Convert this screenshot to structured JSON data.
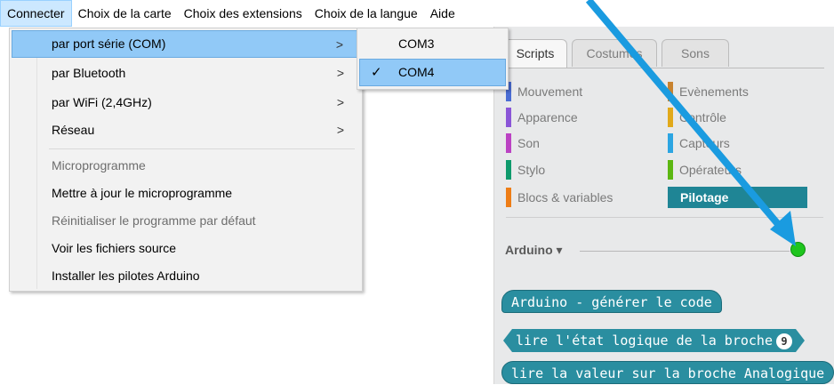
{
  "menubar": {
    "items": [
      "Connecter",
      "Choix de la carte",
      "Choix des extensions",
      "Choix de la langue",
      "Aide"
    ]
  },
  "connect_menu": {
    "items": [
      {
        "label": "par port série (COM)",
        "arrow": ">"
      },
      {
        "label": "par Bluetooth",
        "arrow": ">"
      },
      {
        "label": "par WiFi (2,4GHz)",
        "arrow": ">"
      },
      {
        "label": "Réseau",
        "arrow": ">"
      }
    ],
    "firmware_items": [
      {
        "label": "Microprogramme"
      },
      {
        "label": "Mettre à jour le microprogramme"
      },
      {
        "label": "Réinitialiser le programme par défaut"
      },
      {
        "label": "Voir les fichiers source"
      },
      {
        "label": "Installer les pilotes Arduino"
      }
    ]
  },
  "port_submenu": {
    "items": [
      {
        "label": "COM3",
        "checked": false
      },
      {
        "label": "COM4",
        "checked": true,
        "check_mark": "✓"
      }
    ]
  },
  "tabs": [
    "Scripts",
    "Costumes",
    "Sons"
  ],
  "categories": [
    {
      "label": "Mouvement",
      "color": "#4a6cd4"
    },
    {
      "label": "Evènements",
      "color": "#c88330"
    },
    {
      "label": "Apparence",
      "color": "#8a55d7"
    },
    {
      "label": "Contrôle",
      "color": "#e1a91a"
    },
    {
      "label": "Son",
      "color": "#bb42c3"
    },
    {
      "label": "Capteurs",
      "color": "#2ca5e2"
    },
    {
      "label": "Stylo",
      "color": "#0e9a6c"
    },
    {
      "label": "Opérateurs",
      "color": "#5cb712"
    },
    {
      "label": "Blocs & variables",
      "color": "#ee7d16"
    },
    {
      "label": "Pilotage",
      "color": "#1f8595"
    }
  ],
  "extension": {
    "title": "Arduino ▾",
    "status_color": "#1ec51e"
  },
  "blocks": [
    {
      "label": "Arduino - générer le code"
    },
    {
      "label": "lire l'état logique de la broche",
      "pin": "9"
    },
    {
      "label": "lire la valeur sur la broche Analogique"
    }
  ],
  "colors": {
    "accent": "#91c9f7",
    "block": "#2a8ea0",
    "annotation_arrow": "#1a9be0"
  }
}
